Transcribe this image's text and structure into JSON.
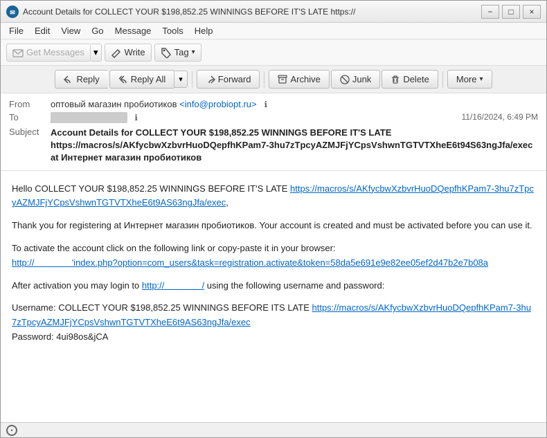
{
  "window": {
    "title": "Account Details for COLLECT YOUR $198,852.25 WINNINGS BEFORE IT'S LATE https://",
    "icon": "TB"
  },
  "titlebar": {
    "minimize_label": "−",
    "maximize_label": "□",
    "close_label": "×"
  },
  "menubar": {
    "items": [
      "File",
      "Edit",
      "View",
      "Go",
      "Message",
      "Tools",
      "Help"
    ]
  },
  "toolbar": {
    "get_messages_label": "Get Messages",
    "write_label": "Write",
    "tag_label": "Tag"
  },
  "email_toolbar": {
    "reply_label": "Reply",
    "reply_all_label": "Reply All",
    "forward_label": "Forward",
    "archive_label": "Archive",
    "junk_label": "Junk",
    "delete_label": "Delete",
    "more_label": "More"
  },
  "email_header": {
    "from_label": "From",
    "from_name": "оптовый магазин пробиотиков",
    "from_email": "<info@probiopt.ru>",
    "to_label": "To",
    "to_value": "████████████",
    "date": "11/16/2024, 6:49 PM",
    "subject_label": "Subject",
    "subject_text": "Account Details for COLLECT YOUR $198,852.25 WINNINGS BEFORE IT'S LATE https://macros/s/AKfycbwXzbvrHuoDQepfhKPam7-3hu7zTpcyAZMJFjYCpsVshwnTGTVTXheE6t94S63ngJfa/exec at Интернет магазин пробиотиков"
  },
  "email_body": {
    "greeting": "Hello COLLECT YOUR $198,852.25 WINNINGS BEFORE IT'S LATE",
    "link1_text": "https://macros/s/AKfycbwXzbvrHuoDQepfhKPam7-3hu7zTpcyAZMJFjYCpsVshwnTGTVTXheE6t9AS63ngJfa/exec",
    "link1_href": "https://macros/s/AKfycbwXzbvrHuoDQepfhKPam7-3hu7zTpcyAZMJFjYCpsVshwnTGTVTXheE6t9AS63ngJfa/exec",
    "para1": "Thank you for registering at Интернет магазин пробиотиков. Your account is created and must be activated before you can use it.",
    "para2_prefix": "To activate the account click on the following link or copy-paste it in your browser:",
    "link2_text": "http://                    'index.php?option=com_users&task=registration.activate&token=58da5e691e9e82ee05ef2d47b2e7b08a",
    "link2_href": "#",
    "para3_prefix": "After activation you may login to",
    "link3_text": "http://                   /",
    "link3_href": "#",
    "para3_suffix": "using the following username and password:",
    "username_label": "Username:",
    "username_value": "COLLECT YOUR $198,852.25 WINNINGS BEFORE ITS LATE",
    "username_link": "https://macros/s/AKfycbwXzbvrHuoDQepfhKPam7-3hu7zTpcyAZMJFjYCpsVshwnTGTVTXheE6t9AS63ngJfa/exec",
    "password_label": "Password:",
    "password_value": "4ui98os&jCA"
  },
  "statusbar": {
    "icon_label": "(•)",
    "text": ""
  }
}
